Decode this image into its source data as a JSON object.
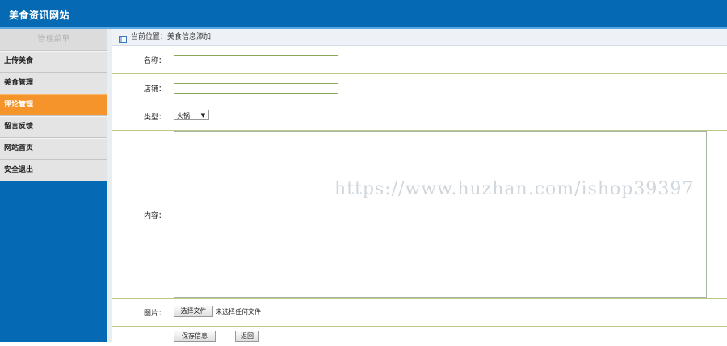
{
  "site": {
    "title": "美食资讯网站"
  },
  "sidebar": {
    "header": "管理菜单",
    "items": [
      {
        "label": "上传美食"
      },
      {
        "label": "美食管理"
      },
      {
        "label": "评论管理"
      },
      {
        "label": "留言反馈"
      },
      {
        "label": "网站首页"
      },
      {
        "label": "安全退出"
      }
    ]
  },
  "breadcrumb": {
    "text": "当前位置：美食信息添加"
  },
  "form": {
    "name_label": "名称：",
    "name_value": "",
    "shop_label": "店铺：",
    "shop_value": "",
    "type_label": "类型：",
    "type_selected": "火锅",
    "content_label": "内容：",
    "image_label": "图片：",
    "file_button": "选择文件",
    "file_status": "未选择任何文件",
    "save_button": "保存信息",
    "back_button": "返回"
  },
  "watermark": "https://www.huzhan.com/ishop39397",
  "colors": {
    "header_bg": "#0669b4",
    "active_item": "#f5942a",
    "row_border": "#b8c98a"
  }
}
